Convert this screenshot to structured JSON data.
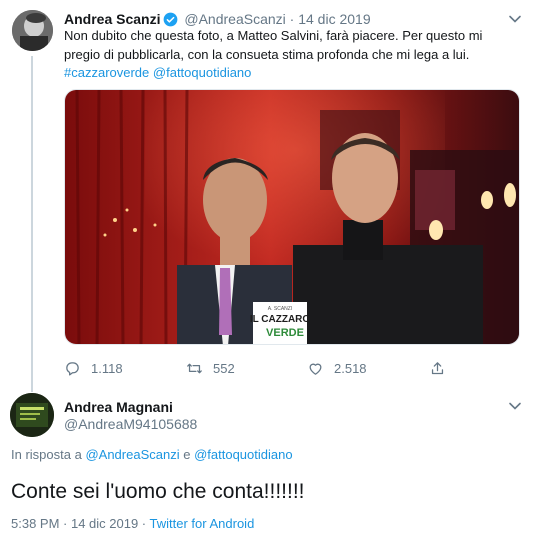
{
  "tweet": {
    "author_name": "Andrea Scanzi",
    "handle": "@AndreaScanzi",
    "separator": "·",
    "date": "14 dic 2019",
    "text_line1": "Non dubito che questa foto, a Matteo Salvini, farà piacere. Per questo mi",
    "text_line2": "pregio di pubblicarla, con la consueta stima profonda che mi lega a lui.",
    "hashtag": "#cazzaroverde",
    "mention": "@fattoquotidiano",
    "photo_book_small": "A. SCANZI",
    "photo_book_title1": "IL CAZZARO",
    "photo_book_title2": "VERDE",
    "reply_count": "1.118",
    "retweet_count": "552",
    "like_count": "2.518"
  },
  "reply": {
    "author_name": "Andrea Magnani",
    "handle": "@AndreaM94105688",
    "in_reply_prefix": "In risposta a",
    "in_reply_user1": "@AndreaScanzi",
    "in_reply_and": "e",
    "in_reply_user2": "@fattoquotidiano",
    "text": "Conte sei l'uomo che conta!!!!!!!",
    "time": "5:38 PM · 14 dic 2019 ·",
    "source": "Twitter for Android"
  },
  "colors": {
    "link": "#1b95e0",
    "muted": "#657786",
    "text": "#14171a"
  }
}
